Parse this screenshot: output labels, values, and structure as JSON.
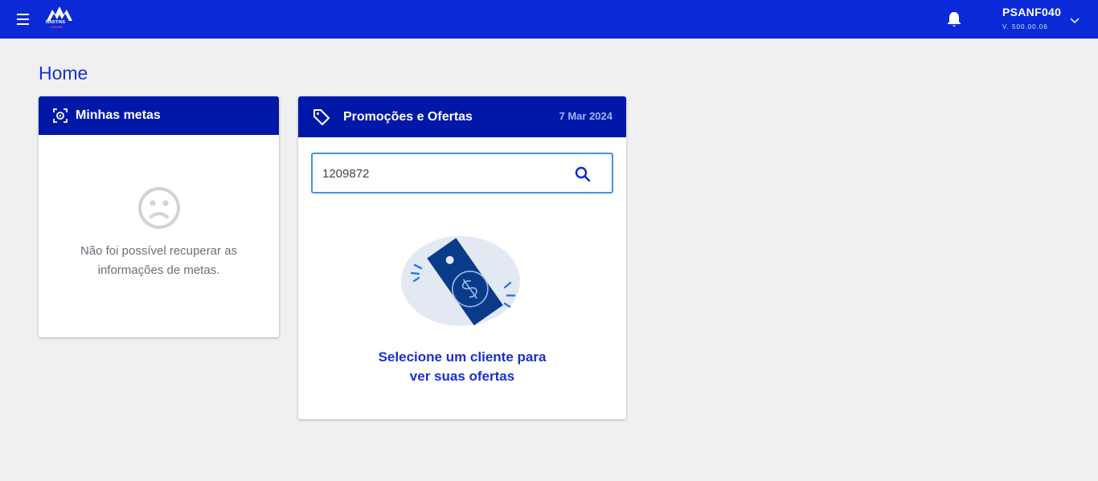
{
  "topbar": {
    "menu_icon": "hamburger-menu-icon",
    "logo_text": "MARTINS",
    "logo_sub": ".COM.BR",
    "bell_icon": "bell-icon",
    "user_name": "PSANF040",
    "user_version": "V. 500.00.06",
    "chevron_icon": "chevron-down-icon"
  },
  "page": {
    "title": "Home"
  },
  "metas_card": {
    "title": "Minhas metas",
    "icon": "target-scan-icon",
    "empty_icon": "sad-face-icon",
    "message": "Não foi possível recuperar as informações de metas."
  },
  "promo_card": {
    "title": "Promoções e Ofertas",
    "icon": "tag-icon",
    "date": "7 Mar 2024",
    "search": {
      "value": "1209872",
      "placeholder": ""
    },
    "empty_illustration": "price-tag-illustration",
    "message_line1": "Selecione um cliente para",
    "message_line2": "ver suas ofertas"
  },
  "colors": {
    "topbar": "#0a2ad8",
    "card_header": "#0018a8",
    "accent_text": "#1b2fd6",
    "date_text": "#9fb3ff",
    "background": "#f0f0f3"
  }
}
